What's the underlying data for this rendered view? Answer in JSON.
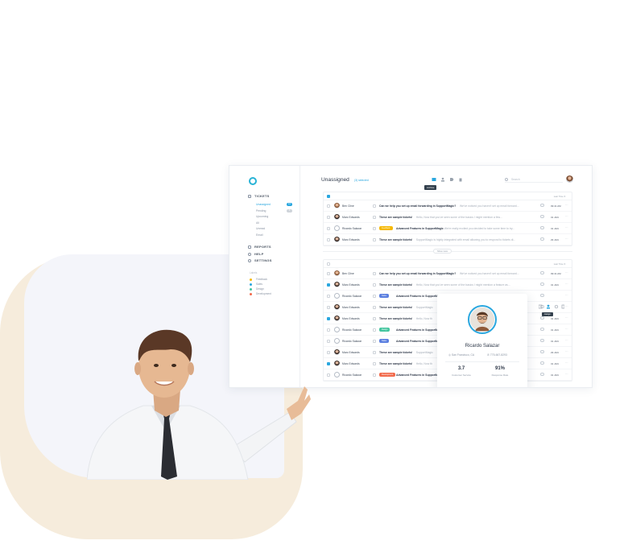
{
  "colors": {
    "accent": "#2aa7df",
    "backdrop": "#f6ecdc"
  },
  "sidebar": {
    "sections": [
      {
        "label": "TICKETS",
        "icon": "ticket-icon"
      },
      {
        "label": "REPORTS",
        "icon": "chart-icon"
      },
      {
        "label": "HELP",
        "icon": "help-icon"
      },
      {
        "label": "SETTINGS",
        "icon": "gear-icon"
      }
    ],
    "ticket_views": [
      "Unassigned",
      "Pending",
      "Upcoming",
      "All",
      "Unread",
      "Email"
    ],
    "counts": [
      "12",
      "3"
    ],
    "labels_heading": "Labels",
    "labels": [
      {
        "name": "Feedback",
        "color": "#f5b800"
      },
      {
        "name": "Sales",
        "color": "#2aa7df"
      },
      {
        "name": "Design",
        "color": "#43c59e"
      },
      {
        "name": "Development",
        "color": "#f26a4b"
      }
    ]
  },
  "header": {
    "title": "Unassigned",
    "selected": "(3) selected",
    "tooltip": "Archive",
    "search_placeholder": "Search"
  },
  "sort_label": "Last Time",
  "show_more": "Show more",
  "tickets_top": [
    {
      "name": "Ben Cline",
      "subject": "Can we help you set up email forwarding in SupportMagic?",
      "preview": "We've noticed you haven't set up email forward...",
      "date": "09:41 AM",
      "checked": false
    },
    {
      "name": "Marc Edwards",
      "subject": "These are sample tickets!",
      "preview": "Hello, Now that you've seen some of the basics I might mention a few...",
      "date": "31 JAN",
      "checked": false
    },
    {
      "name": "Ricardo Salazar",
      "pill": "Feedback",
      "subject": "Advanced Features in SupportMagic",
      "preview": "We're really excited you decided to take some time to try...",
      "date": "31 JAN",
      "checked": false
    },
    {
      "name": "Marc Edwards",
      "subject": "These are sample tickets!",
      "preview": "SupportMagic is highly integrated with email allowing you to respond to tickets di...",
      "date": "29 JAN",
      "checked": false
    }
  ],
  "tickets_bottom": [
    {
      "name": "Ben Cline",
      "subject": "Can we help you set up email forwarding in SupportMagic?",
      "preview": "We've noticed you haven't set up email forward...",
      "date": "09:41 AM",
      "checked": false
    },
    {
      "name": "Marc Edwards",
      "subject": "These are sample tickets!",
      "preview": "Hello, Now that you've seen some of the basics I might mention a feature as...",
      "date": "31 JAN",
      "checked": true
    },
    {
      "name": "Ricardo Salazar",
      "pill": "Sales",
      "subject": "Advanced Features in SupportMagic",
      "preview": "",
      "date": "",
      "checked": false
    },
    {
      "name": "Marc Edwards",
      "subject": "These are sample tickets!",
      "preview": "SupportMagic",
      "date": "",
      "checked": false
    },
    {
      "name": "Marc Edwards",
      "subject": "These are sample tickets!",
      "preview": "Hello, Now th",
      "date": "31 JAN",
      "checked": true
    },
    {
      "name": "Ricardo Salazar",
      "pill": "Design",
      "subject": "Advanced Features in SupportM",
      "preview": "",
      "date": "31 JAN",
      "checked": false
    },
    {
      "name": "Ricardo Salazar",
      "pill": "Sales",
      "subject": "Advanced Features in SupportM",
      "preview": "",
      "date": "31 JAN",
      "checked": false
    },
    {
      "name": "Marc Edwards",
      "subject": "These are sample tickets!",
      "preview": "SupportMagic",
      "date": "29 JAN",
      "checked": false
    },
    {
      "name": "Marc Edwards",
      "subject": "These are sample tickets!",
      "preview": "Hello, Now th",
      "date": "31 JAN",
      "checked": true
    },
    {
      "name": "Ricardo Salazar",
      "pill": "Development",
      "subject": "Advanced Features in SupportM",
      "preview": "",
      "date": "31 JAN",
      "checked": false
    }
  ],
  "profile": {
    "name": "Ricardo Salazar",
    "location": "San Francisco, CA",
    "phone": "775-667-8293",
    "rating": "3.7",
    "rating_label": "Customer Service",
    "response": "91%",
    "response_label": "Response Rate"
  },
  "assign_tooltip": "Assign"
}
